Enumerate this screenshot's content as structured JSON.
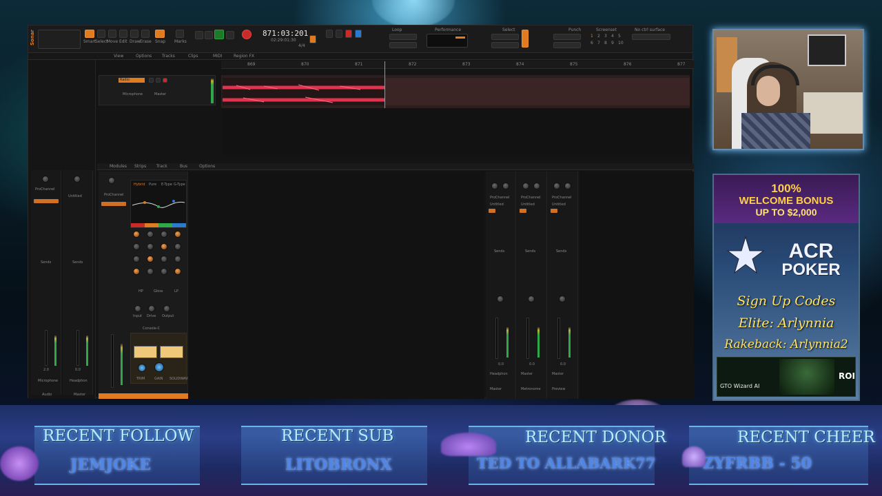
{
  "daw": {
    "app_name": "Sonar",
    "time_display": "871:03:201",
    "time_sub": "02:29:01:30",
    "tempo": "4/4",
    "menu": [
      "View",
      "Options",
      "Tracks",
      "Clips",
      "MIDI",
      "Region FX"
    ],
    "mode_labels": [
      "Smart",
      "Select",
      "Move",
      "Edit",
      "Draw",
      "Erase",
      "Snap",
      "Marks"
    ],
    "groups": [
      "Loop",
      "Performance",
      "Select",
      "Punch",
      "Screenset",
      "No ctrl surface"
    ],
    "screenset_numbers": [
      "1",
      "2",
      "3",
      "4",
      "5",
      "6",
      "7",
      "8",
      "9",
      "10"
    ],
    "ruler": [
      "869",
      "870",
      "871",
      "872",
      "873",
      "874",
      "875",
      "876",
      "877"
    ],
    "track": {
      "name": "Radio",
      "input": "Microphone",
      "output": "Master"
    },
    "tabs": [
      "Modules",
      "Strips",
      "Track",
      "Bus",
      "Options"
    ],
    "prochannel_label": "ProChannel",
    "eq_types": [
      "Hybrid",
      "Pure",
      "E-Type",
      "G-Type"
    ],
    "eq_bands": [
      "HP",
      "Gloss",
      "LP"
    ],
    "console_label": "Console-C",
    "drive_labels": [
      "Input",
      "Drive",
      "Output"
    ],
    "comp_labels": [
      "TRIM",
      "GAIN",
      "SOLIDWAVE"
    ],
    "left_strips": [
      {
        "name": "Microphone",
        "fader": "2.0",
        "out": "Audio"
      },
      {
        "name": "Headphon",
        "fader": "0.0",
        "out": "Master"
      }
    ],
    "right_strips": [
      {
        "name": "Headphon",
        "fader": "0.0",
        "label": "Master"
      },
      {
        "name": "Master",
        "fader": "0.0",
        "label": "Metronome"
      },
      {
        "name": "Master",
        "fader": "0.0",
        "label": "Preview"
      }
    ],
    "sends_label": "Sends",
    "untitled": "Untitled"
  },
  "ad": {
    "bonus_line1": "100%",
    "bonus_line2": "WELCOME BONUS",
    "bonus_line3": "UP TO $2,000",
    "brand_line1": "ACR",
    "brand_line2": "POKER",
    "signup": "Sign Up Codes",
    "elite": "Elite: Arlynnia",
    "rakeback": "Rakeback: Arlynnia2",
    "gto_text": "GTO Wizard AI",
    "roi_text": "ROI"
  },
  "bottom": [
    {
      "title": "RECENT FOLLOW",
      "name": "JEMJOKE"
    },
    {
      "title": "RECENT SUB",
      "name": "LITOBRONX"
    },
    {
      "title": "RECENT DONOR",
      "name": "TED TO ALLABARK77"
    },
    {
      "title": "RECENT CHEER",
      "name": "ZYFRBB - 50"
    }
  ],
  "colors": {
    "accent": "#e07b20",
    "wave": "#e0334f",
    "overlay_text": "#bde9ff"
  }
}
